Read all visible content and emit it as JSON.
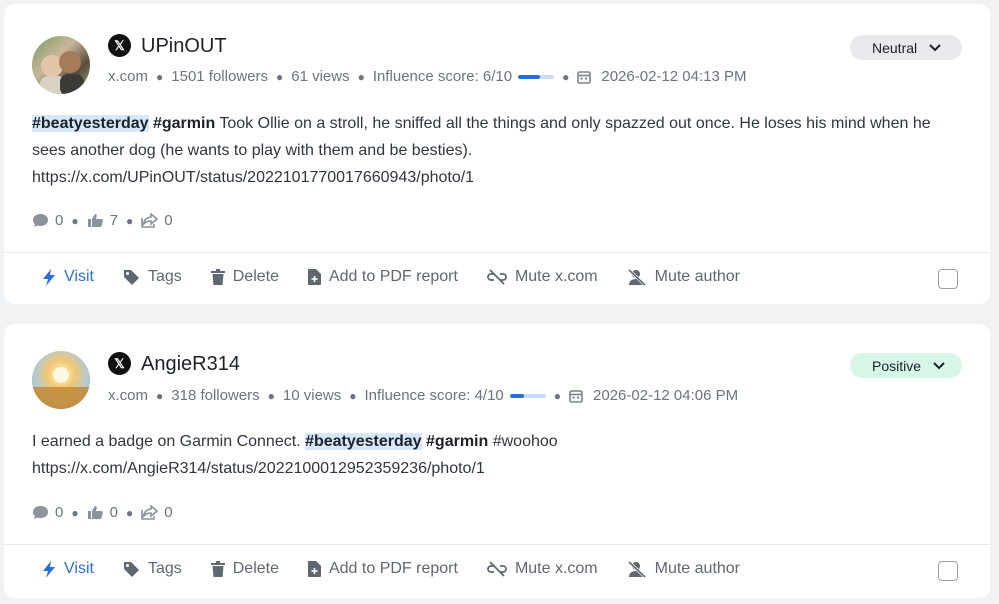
{
  "posts": [
    {
      "author": "UPinOUT",
      "source_icon": "x-logo-icon",
      "source_glyph": "𝕏",
      "source": "x.com",
      "followers": "1501 followers",
      "views": "61 views",
      "influence_label": "Influence score: 6/10",
      "influence_score": 0.6,
      "datetime": "2026-02-12 04:13 PM",
      "sentiment": "Neutral",
      "hashtag_highlight": "#beatyesterday",
      "hashtag": "#garmin",
      "text": " Took Ollie on a stroll, he sniffed all the things and only spazzed out once. He loses his mind when he sees another dog (he wants to play with them and be besties).",
      "link": "https://x.com/UPinOUT/status/2022101770017660943/photo/1",
      "comments": "0",
      "likes": "7",
      "shares": "0"
    },
    {
      "author": "AngieR314",
      "source_icon": "x-logo-icon",
      "source_glyph": "𝕏",
      "source": "x.com",
      "followers": "318 followers",
      "views": "10 views",
      "influence_label": "Influence score: 4/10",
      "influence_score": 0.4,
      "datetime": "2026-02-12 04:06 PM",
      "sentiment": "Positive",
      "text_before": "I earned a badge on Garmin Connect. ",
      "hashtag_highlight": "#beatyesterday",
      "hashtag": "#garmin",
      "text_after": " #woohoo",
      "link": "https://x.com/AngieR314/status/2022100012952359236/photo/1",
      "comments": "0",
      "likes": "0",
      "shares": "0"
    }
  ],
  "actions": {
    "visit": "Visit",
    "tags": "Tags",
    "delete": "Delete",
    "pdf": "Add to PDF report",
    "mute_source": "Mute x.com",
    "mute_author": "Mute author"
  },
  "colors": {
    "accent": "#2b6fd6",
    "neutral_pill": "#e7e9ec",
    "positive_pill": "#d6f6e6",
    "highlight": "#d7e6f8"
  }
}
